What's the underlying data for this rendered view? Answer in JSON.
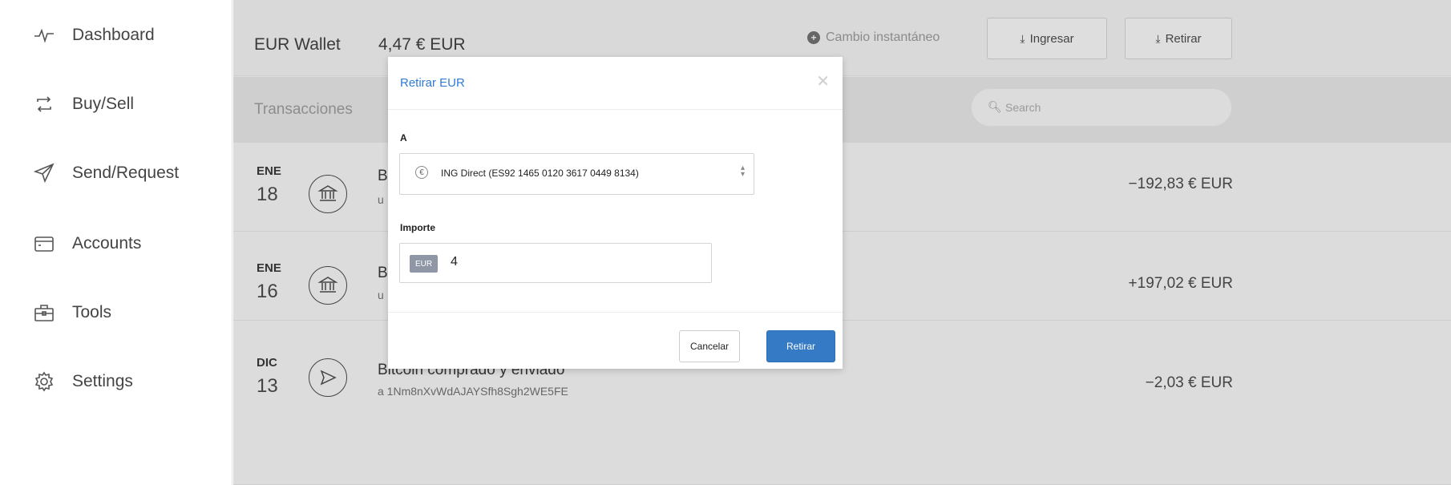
{
  "sidebar": {
    "items": [
      {
        "label": "Dashboard",
        "icon": "activity-icon"
      },
      {
        "label": "Buy/Sell",
        "icon": "exchange-icon"
      },
      {
        "label": "Send/Request",
        "icon": "send-icon"
      },
      {
        "label": "Accounts",
        "icon": "folder-icon"
      },
      {
        "label": "Tools",
        "icon": "briefcase-icon"
      },
      {
        "label": "Settings",
        "icon": "gear-icon"
      }
    ]
  },
  "header": {
    "wallet_title": "EUR Wallet",
    "balance": "4,47 € EUR",
    "instant_exchange": "Cambio instantáneo",
    "deposit_label": "Ingresar",
    "withdraw_label": "Retirar"
  },
  "transactions": {
    "title": "Transacciones",
    "search_placeholder": "Search",
    "rows": [
      {
        "month": "ENE",
        "day": "18",
        "desc": "B",
        "sub": "u",
        "amount": "−192,83 € EUR",
        "icon": "bank-icon"
      },
      {
        "month": "ENE",
        "day": "16",
        "desc": "B",
        "sub": "u",
        "amount": "+197,02 € EUR",
        "icon": "bank-icon"
      },
      {
        "month": "DIC",
        "day": "13",
        "desc": "Bitcoin comprado y enviado",
        "sub": "a 1Nm8nXvWdAJAYSfh8Sgh2WE5FE",
        "amount": "−2,03 € EUR",
        "icon": "send-icon"
      }
    ]
  },
  "modal": {
    "title": "Retirar EUR",
    "to_label": "A",
    "account_value": "ING Direct (ES92 1465 0120 3617 0449 8134)",
    "amount_label": "Importe",
    "currency_badge": "EUR",
    "amount_value": "4",
    "cancel_label": "Cancelar",
    "submit_label": "Retirar"
  },
  "colors": {
    "accent": "#357ac4",
    "link": "#2f7bd6",
    "overlay_bg": "#dcdcdc"
  }
}
